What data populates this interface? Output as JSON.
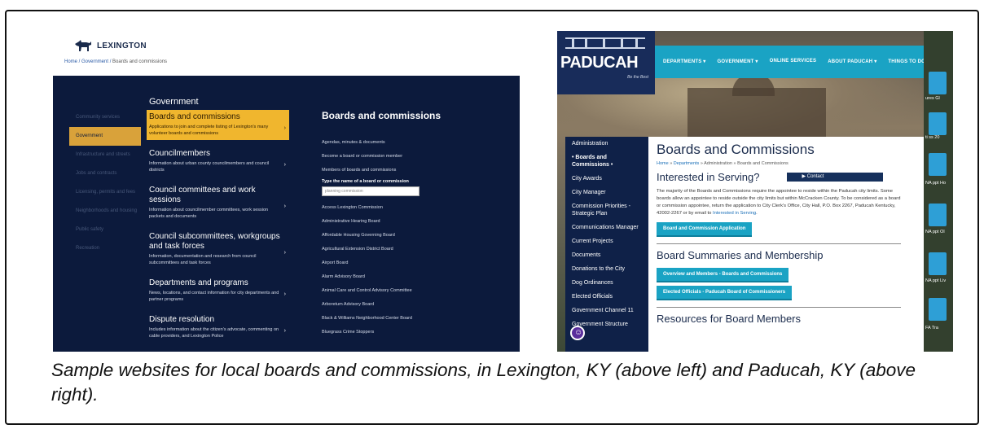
{
  "lexington": {
    "logo_text": "LEXINGTON",
    "breadcrumb": {
      "home": "Home / Government / ",
      "current": "Boards and commissions"
    },
    "sidebar": [
      "Community services",
      "Government",
      "Infrastructure and streets",
      "Jobs and contracts",
      "Licensing, permits and fees",
      "Neighborhoods and housing",
      "Public safety",
      "Recreation"
    ],
    "menu_heading": "Government",
    "menu": [
      {
        "title": "Boards and commissions",
        "desc": "Applications to join and complete listing of Lexington's many volunteer boards and commissions"
      },
      {
        "title": "Councilmembers",
        "desc": "Information about urban county councilmembers and council districts"
      },
      {
        "title": "Council committees and work sessions",
        "desc": "Information about councilmember committees, work session packets and documents"
      },
      {
        "title": "Council subcommittees, workgroups and task forces",
        "desc": "Information, documentation and research from council subcommittees and task forces"
      },
      {
        "title": "Departments and programs",
        "desc": "News, locations, and contact information for city departments and partner programs"
      },
      {
        "title": "Dispute resolution",
        "desc": "Includes information about the citizen's advocate, commenting on cable providers, and Lexington Police"
      }
    ],
    "right_heading": "Boards and commissions",
    "links_top": [
      "Agendas, minutes & documents",
      "Become a board or commission member",
      "Members of boards and commissions"
    ],
    "search_label": "Type the name of a board or commission",
    "search_placeholder": "planning commission",
    "links_bottom": [
      "Access Lexington Commission",
      "Administrative Hearing Board",
      "Affordable Housing Governing Board",
      "Agricultural Extension District Board",
      "Airport Board",
      "Alarm Advisory Board",
      "Animal Care and Control Advisory Committee",
      "Arboretum Advisory Board",
      "Black & Williams Neighborhood Center Board",
      "Bluegrass Crime Stoppers"
    ]
  },
  "paducah": {
    "logo_name": "PADUCAH",
    "logo_tag": "Be the Best",
    "nav": [
      "DEPARTMENTS ▾",
      "GOVERNMENT ▾",
      "ONLINE SERVICES",
      "ABOUT PADUCAH ▾",
      "THINGS TO DO ▾"
    ],
    "sidebar": [
      "Administration",
      "• Boards and Commissions •",
      "City Awards",
      "City Manager",
      "Commission Priorities - Strategic Plan",
      "Communications Manager",
      "Current Projects",
      "Documents",
      "Donations to the City",
      "Dog Ordinances",
      "Elected Officials",
      "Government Channel 11",
      "Government Structure"
    ],
    "title": "Boards and Commissions",
    "breadcrumb": {
      "home": "Home",
      "sep": " » ",
      "dept": "Departments",
      "admin": "Administration",
      "cur": "Boards and Commissions"
    },
    "interested_heading": "Interested in Serving?",
    "contact_label": "▶ Contact",
    "paragraph": "The majority of the Boards and Commissions require the appointee to reside within the Paducah city limits. Some boards allow an appointee to reside outside the city limits but within McCracken County. To be considered as a board or commission appointee, return the application to City Clerk's Office, City Hall, P.O. Box 2267, Paducah Kentucky, 42002-2267 or by email to ",
    "paragraph_link": "Interested in Serving",
    "paragraph_end": ".",
    "app_button": "Board and Commission Application",
    "summaries_heading": "Board Summaries and Membership",
    "overview_button": "Overview and Members - Boards and Commissions",
    "elected_button": "Elected Officials - Paducah Board of Commissioners",
    "resources_heading": "Resources for Board Members",
    "strip_labels": [
      "ures Gl",
      "ti ss 20",
      "NA ppt Ho",
      "NA ppt Ol",
      "NA ppt Liv",
      "FA   Tra"
    ]
  },
  "caption": "Sample websites for local boards and commissions, in Lexington, KY (above left) and Paducah, KY (above right)."
}
